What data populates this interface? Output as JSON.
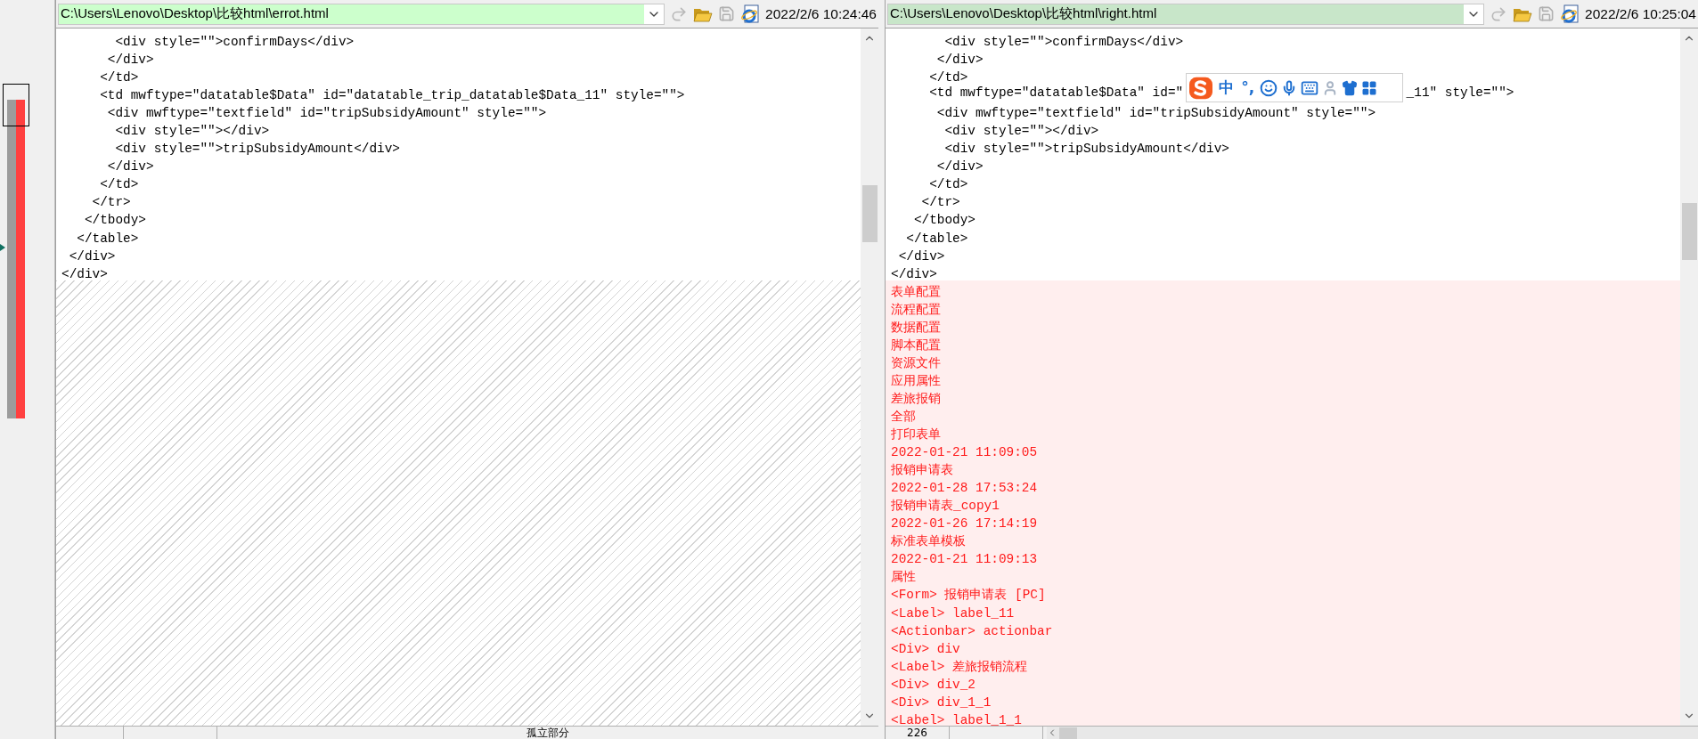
{
  "panes": [
    {
      "path": "C:\\Users\\Lenovo\\Desktop\\比较html\\errot.html",
      "timestamp": "2022/2/6 10:24:46",
      "status": [
        "孤立部分"
      ],
      "lines": [
        {
          "kind": "same",
          "text": "       <div style=\"\">confirmDays</div>"
        },
        {
          "kind": "same",
          "text": "      </div>"
        },
        {
          "kind": "same",
          "text": "     </td>"
        },
        {
          "kind": "same",
          "text": "     <td mwftype=\"datatable$Data\" id=\"datatable_trip_datatable$Data_11\" style=\"\">"
        },
        {
          "kind": "same",
          "text": "      <div mwftype=\"textfield\" id=\"tripSubsidyAmount\" style=\"\">"
        },
        {
          "kind": "same",
          "text": "       <div style=\"\"></div>"
        },
        {
          "kind": "same",
          "text": "       <div style=\"\">tripSubsidyAmount</div>"
        },
        {
          "kind": "same",
          "text": "      </div>"
        },
        {
          "kind": "same",
          "text": "     </td>"
        },
        {
          "kind": "same",
          "text": "    </tr>"
        },
        {
          "kind": "same",
          "text": "   </tbody>"
        },
        {
          "kind": "same",
          "text": "  </table>"
        },
        {
          "kind": "same",
          "text": " </div>"
        },
        {
          "kind": "same",
          "text": "</div>"
        }
      ]
    },
    {
      "path": "C:\\Users\\Lenovo\\Desktop\\比较html\\right.html",
      "timestamp": "2022/2/6 10:25:04",
      "status": [
        "226"
      ],
      "lines": [
        {
          "kind": "same",
          "text": "       <div style=\"\">confirmDays</div>"
        },
        {
          "kind": "same",
          "text": "      </div>"
        },
        {
          "kind": "same",
          "text": "     </td>"
        },
        {
          "kind": "same",
          "parts": [
            "     <td mwftype=\"datatable$Data\" id=\"",
            "_11\" style=\"\">"
          ]
        },
        {
          "kind": "same",
          "text": "      <div mwftype=\"textfield\" id=\"tripSubsidyAmount\" style=\"\">"
        },
        {
          "kind": "same",
          "text": "       <div style=\"\"></div>"
        },
        {
          "kind": "same",
          "text": "       <div style=\"\">tripSubsidyAmount</div>"
        },
        {
          "kind": "same",
          "text": "      </div>"
        },
        {
          "kind": "same",
          "text": "     </td>"
        },
        {
          "kind": "same",
          "text": "    </tr>"
        },
        {
          "kind": "same",
          "text": "   </tbody>"
        },
        {
          "kind": "same",
          "text": "  </table>"
        },
        {
          "kind": "same",
          "text": " </div>"
        },
        {
          "kind": "same",
          "text": "</div>"
        },
        {
          "kind": "added",
          "text": "表单配置"
        },
        {
          "kind": "added",
          "text": "流程配置"
        },
        {
          "kind": "added",
          "text": "数据配置"
        },
        {
          "kind": "added",
          "text": "脚本配置"
        },
        {
          "kind": "added",
          "text": "资源文件"
        },
        {
          "kind": "added",
          "text": "应用属性"
        },
        {
          "kind": "added",
          "text": "差旅报销"
        },
        {
          "kind": "added",
          "text": "全部"
        },
        {
          "kind": "added",
          "text": "打印表单"
        },
        {
          "kind": "added",
          "text": "2022-01-21 11:09:05"
        },
        {
          "kind": "added",
          "text": "报销申请表"
        },
        {
          "kind": "added",
          "text": "2022-01-28 17:53:24"
        },
        {
          "kind": "added",
          "text": "报销申请表_copy1"
        },
        {
          "kind": "added",
          "text": "2022-01-26 17:14:19"
        },
        {
          "kind": "added",
          "text": "标准表单模板"
        },
        {
          "kind": "added",
          "text": "2022-01-21 11:09:13"
        },
        {
          "kind": "added",
          "text": "属性"
        },
        {
          "kind": "added",
          "text": "<Form> 报销申请表 [PC]"
        },
        {
          "kind": "added",
          "text": "<Label> label_11"
        },
        {
          "kind": "added",
          "text": "<Actionbar> actionbar"
        },
        {
          "kind": "added",
          "text": "<Div> div"
        },
        {
          "kind": "added",
          "text": "<Label> 差旅报销流程"
        },
        {
          "kind": "added",
          "text": "<Div> div_2"
        },
        {
          "kind": "added",
          "text": "<Div> div_1_1"
        },
        {
          "kind": "added",
          "text": "<Label> label_1_1"
        }
      ]
    }
  ],
  "ime_toolbar": {
    "labels": [
      "中",
      "°,"
    ]
  }
}
